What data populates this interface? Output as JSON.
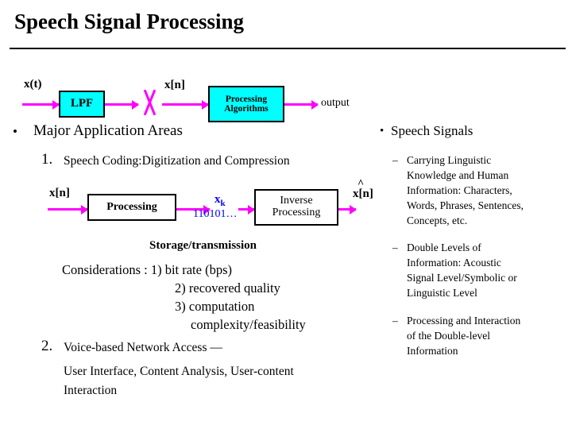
{
  "slide": {
    "title": "Speech Signal Processing"
  },
  "diagram_top": {
    "xt_label": "x(t)",
    "lpf_box": "LPF",
    "xn_label": "x[n]",
    "processing_box_line1": "Processing",
    "processing_box_line2": "Algorithms",
    "output_label": "output"
  },
  "left_column": {
    "bullet": "•",
    "heading": "Major Application Areas",
    "item1_number": "1.",
    "item1_text": "Speech Coding:Digitization and Compression",
    "item2_number": "2.",
    "item2_text": "Voice-based Network Access —",
    "item2_sub_line1": "User Interface, Content Analysis, User-content",
    "item2_sub_line2": "Interaction"
  },
  "diagram_mid": {
    "xn_label": "x[n]",
    "processing_box": "Processing",
    "xk_label": "x",
    "xk_sub": "k",
    "bits_label": "110101…",
    "inverse_box_line1": "Inverse",
    "inverse_box_line2": "Processing",
    "xhat_hat": "^",
    "xhat_label": "x[n]",
    "storage_label": "Storage/transmission",
    "considerations_line1": "Considerations :  1) bit rate (bps)",
    "considerations_line2": "2) recovered quality",
    "considerations_line3": "3) computation",
    "considerations_line4": "complexity/feasibility"
  },
  "right_column": {
    "bullet": "•",
    "heading": "Speech Signals",
    "items": [
      {
        "dash": "–",
        "lines": [
          "Carrying Linguistic",
          "Knowledge and Human",
          "Information: Characters,",
          "Words, Phrases, Sentences,",
          "Concepts, etc."
        ]
      },
      {
        "dash": "–",
        "lines": [
          "Double Levels of",
          "Information: Acoustic",
          "Signal Level/Symbolic or",
          "Linguistic Level"
        ]
      },
      {
        "dash": "–",
        "lines": [
          "Processing and Interaction",
          "of the Double-level",
          "Information"
        ]
      }
    ]
  },
  "colors": {
    "arrow": "#ff00ff",
    "box_fill": "#00ffff",
    "text": "#000000",
    "rule": "#000000"
  }
}
